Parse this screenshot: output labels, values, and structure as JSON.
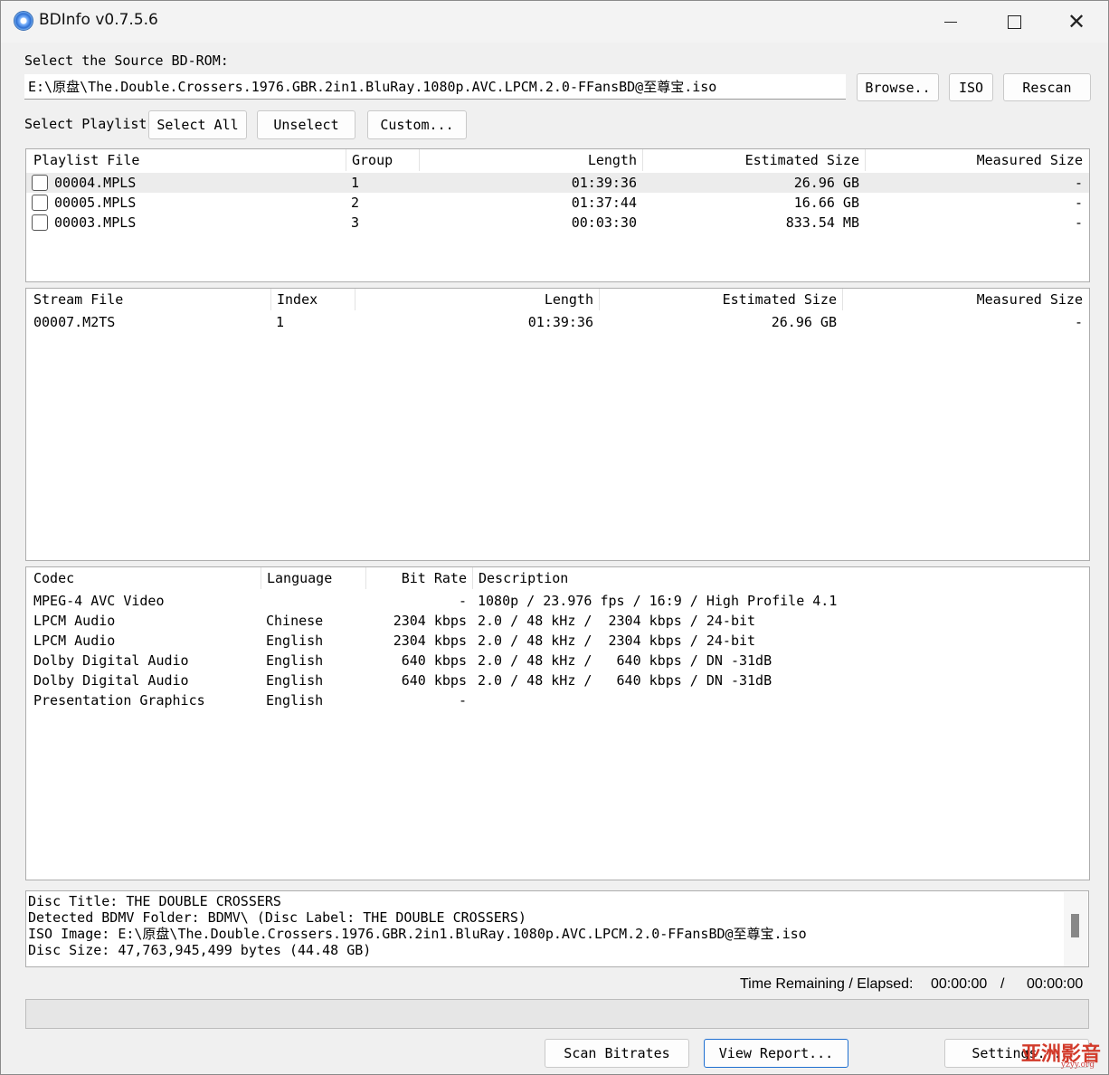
{
  "window": {
    "title": "BDInfo v0.7.5.6"
  },
  "source": {
    "label": "Select the Source BD-ROM:",
    "path": "E:\\原盘\\The.Double.Crossers.1976.GBR.2in1.BluRay.1080p.AVC.LPCM.2.0-FFansBD@至尊宝.iso",
    "browse": "Browse..",
    "iso": "ISO",
    "rescan": "Rescan"
  },
  "playlist_controls": {
    "label": "Select Playlist",
    "select_all": "Select All",
    "unselect": "Unselect",
    "custom": "Custom..."
  },
  "playlists": {
    "headers": [
      "Playlist File",
      "Group",
      "Length",
      "Estimated Size",
      "Measured Size"
    ],
    "rows": [
      {
        "file": "00004.MPLS",
        "group": "1",
        "length": "01:39:36",
        "est": "26.96 GB",
        "meas": "-"
      },
      {
        "file": "00005.MPLS",
        "group": "2",
        "length": "01:37:44",
        "est": "16.66 GB",
        "meas": "-"
      },
      {
        "file": "00003.MPLS",
        "group": "3",
        "length": "00:03:30",
        "est": "833.54 MB",
        "meas": "-"
      }
    ]
  },
  "streams": {
    "headers": [
      "Stream File",
      "Index",
      "Length",
      "Estimated Size",
      "Measured Size"
    ],
    "rows": [
      {
        "file": "00007.M2TS",
        "index": "1",
        "length": "01:39:36",
        "est": "26.96 GB",
        "meas": "-"
      }
    ]
  },
  "codecs": {
    "headers": [
      "Codec",
      "Language",
      "Bit Rate",
      "Description"
    ],
    "rows": [
      {
        "codec": "MPEG-4 AVC Video",
        "lang": "",
        "rate": "-",
        "desc": "1080p / 23.976 fps / 16:9 / High Profile 4.1"
      },
      {
        "codec": "LPCM Audio",
        "lang": "Chinese",
        "rate": "2304 kbps",
        "desc": "2.0 / 48 kHz /  2304 kbps / 24-bit"
      },
      {
        "codec": "LPCM Audio",
        "lang": "English",
        "rate": "2304 kbps",
        "desc": "2.0 / 48 kHz /  2304 kbps / 24-bit"
      },
      {
        "codec": "Dolby Digital Audio",
        "lang": "English",
        "rate": "640 kbps",
        "desc": "2.0 / 48 kHz /   640 kbps / DN -31dB"
      },
      {
        "codec": "Dolby Digital Audio",
        "lang": "English",
        "rate": "640 kbps",
        "desc": "2.0 / 48 kHz /   640 kbps / DN -31dB"
      },
      {
        "codec": "Presentation Graphics",
        "lang": "English",
        "rate": "-",
        "desc": ""
      }
    ]
  },
  "disc_info": [
    "Disc Title: THE DOUBLE CROSSERS",
    "Detected BDMV Folder: BDMV\\ (Disc Label: THE DOUBLE CROSSERS)",
    "ISO Image: E:\\原盘\\The.Double.Crossers.1976.GBR.2in1.BluRay.1080p.AVC.LPCM.2.0-FFansBD@至尊宝.iso",
    "Disc Size: 47,763,945,499 bytes (44.48 GB)"
  ],
  "status": {
    "time_label": "Time Remaining / Elapsed:",
    "remaining": "00:00:00",
    "separator": "/",
    "elapsed": "00:00:00",
    "progress": 0
  },
  "bottom_buttons": {
    "scan": "Scan Bitrates",
    "report": "View Report...",
    "settings": "Settings..."
  },
  "watermark": {
    "main": "亚洲影音",
    "sub": "yzyy.org"
  }
}
